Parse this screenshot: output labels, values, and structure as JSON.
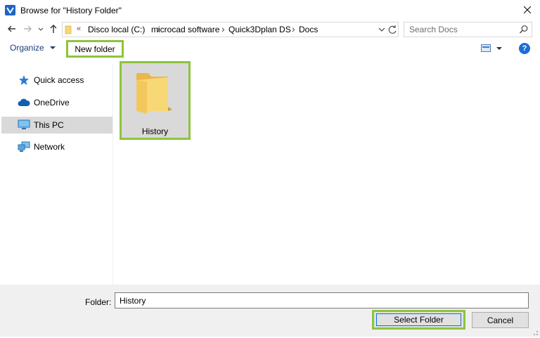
{
  "window": {
    "title": "Browse for \"History Folder\""
  },
  "address": {
    "chevrons": "«",
    "crumbs": [
      "Disco local (C:)",
      "microcad software",
      "Quick3Dplan DS",
      "Docs"
    ]
  },
  "search": {
    "placeholder": "Search Docs"
  },
  "toolbar": {
    "organize_label": "Organize",
    "new_folder_label": "New folder",
    "help_label": "?"
  },
  "sidebar": {
    "items": [
      {
        "label": "Quick access",
        "icon": "star-icon"
      },
      {
        "label": "OneDrive",
        "icon": "cloud-icon"
      },
      {
        "label": "This PC",
        "icon": "monitor-icon",
        "selected": true
      },
      {
        "label": "Network",
        "icon": "network-icon"
      }
    ]
  },
  "content": {
    "items": [
      {
        "label": "History",
        "icon": "folder-icon",
        "selected": true
      }
    ]
  },
  "footer": {
    "folder_label": "Folder:",
    "folder_value": "History",
    "select_label": "Select Folder",
    "cancel_label": "Cancel"
  },
  "colors": {
    "highlight_green": "#8dc43e",
    "selection_gray": "#d9d9d9",
    "folder_yellow": "#f8d775",
    "accent_blue": "#0078d7"
  }
}
